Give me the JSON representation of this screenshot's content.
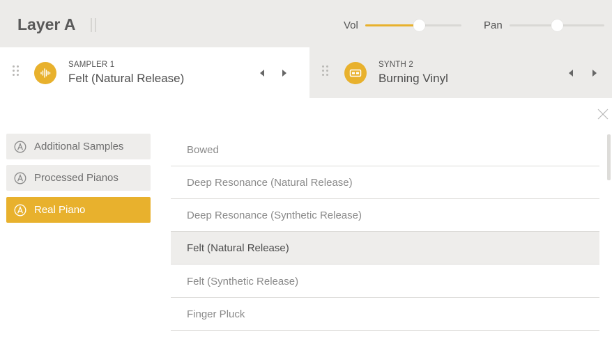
{
  "header": {
    "layer_title": "Layer A",
    "vol_label": "Vol",
    "pan_label": "Pan",
    "vol_value": 0.56,
    "pan_value": 0.5
  },
  "slots": [
    {
      "type": "SAMPLER 1",
      "name": "Felt (Natural Release)",
      "icon": "waveform-icon"
    },
    {
      "type": "SYNTH 2",
      "name": "Burning Vinyl",
      "icon": "synth-module-icon"
    }
  ],
  "categories": [
    {
      "label": "Additional Samples",
      "active": false
    },
    {
      "label": "Processed Pianos",
      "active": false
    },
    {
      "label": "Real Piano",
      "active": true
    }
  ],
  "presets": [
    {
      "label": "Bowed",
      "selected": false
    },
    {
      "label": "Deep Resonance (Natural Release)",
      "selected": false
    },
    {
      "label": "Deep Resonance (Synthetic Release)",
      "selected": false
    },
    {
      "label": "Felt (Natural Release)",
      "selected": true
    },
    {
      "label": "Felt (Synthetic Release)",
      "selected": false
    },
    {
      "label": "Finger Pluck",
      "selected": false
    }
  ],
  "colors": {
    "accent": "#e8b12d",
    "header_bg": "#ecebe9",
    "selected_row": "#eeedeb"
  }
}
